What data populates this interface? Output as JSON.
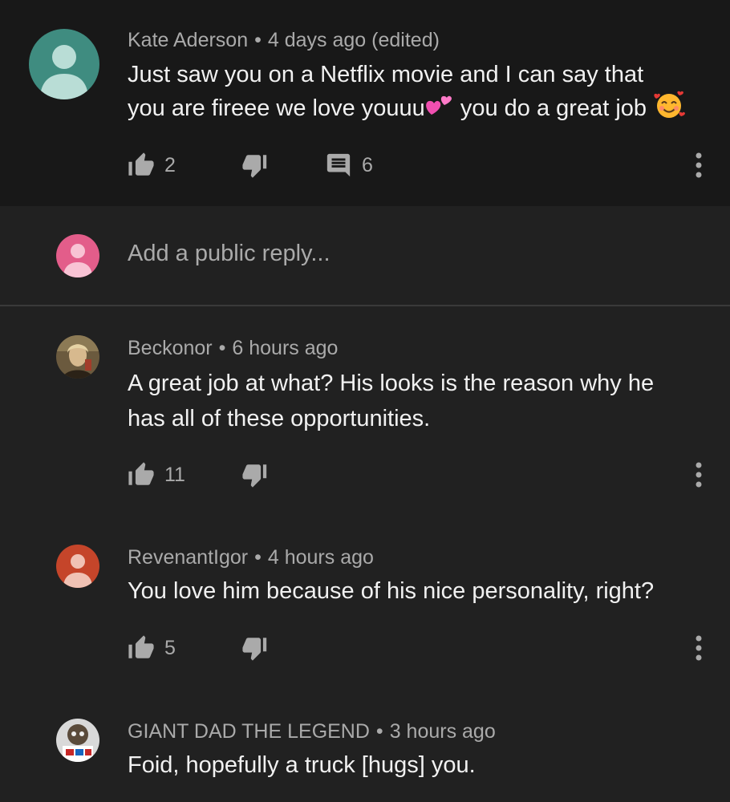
{
  "top_comment": {
    "author": "Kate Aderson",
    "time": "4 days ago (edited)",
    "text_line1": "Just saw you on a Netflix movie and I can say that",
    "text_line2a": "you are fireee we love youuu",
    "text_line2b": " you do a great job ",
    "likes": "2",
    "replies": "6",
    "avatar_color": "#3f8c80"
  },
  "reply_box": {
    "placeholder": "Add a public reply...",
    "avatar_color": "#e35d8a"
  },
  "replies": [
    {
      "author": "Beckonor",
      "time": "6 hours ago",
      "text_line1": "A great job at what? His looks is the reason why he",
      "text_line2": "has all of these opportunities.",
      "likes": "11"
    },
    {
      "author": "RevenantIgor",
      "time": "4 hours ago",
      "text_line1": "You love him because of his nice personality, right?",
      "likes": "5",
      "avatar_color": "#c5452a"
    },
    {
      "author": "GIANT DAD THE LEGEND",
      "time": "3 hours ago",
      "text_line1": "Foid, hopefully a truck [hugs] you."
    }
  ],
  "separator": "•",
  "colors": {
    "background": "#212121",
    "top_background": "#181818",
    "text": "#f1f1f1",
    "meta_text": "#aaaaaa"
  }
}
